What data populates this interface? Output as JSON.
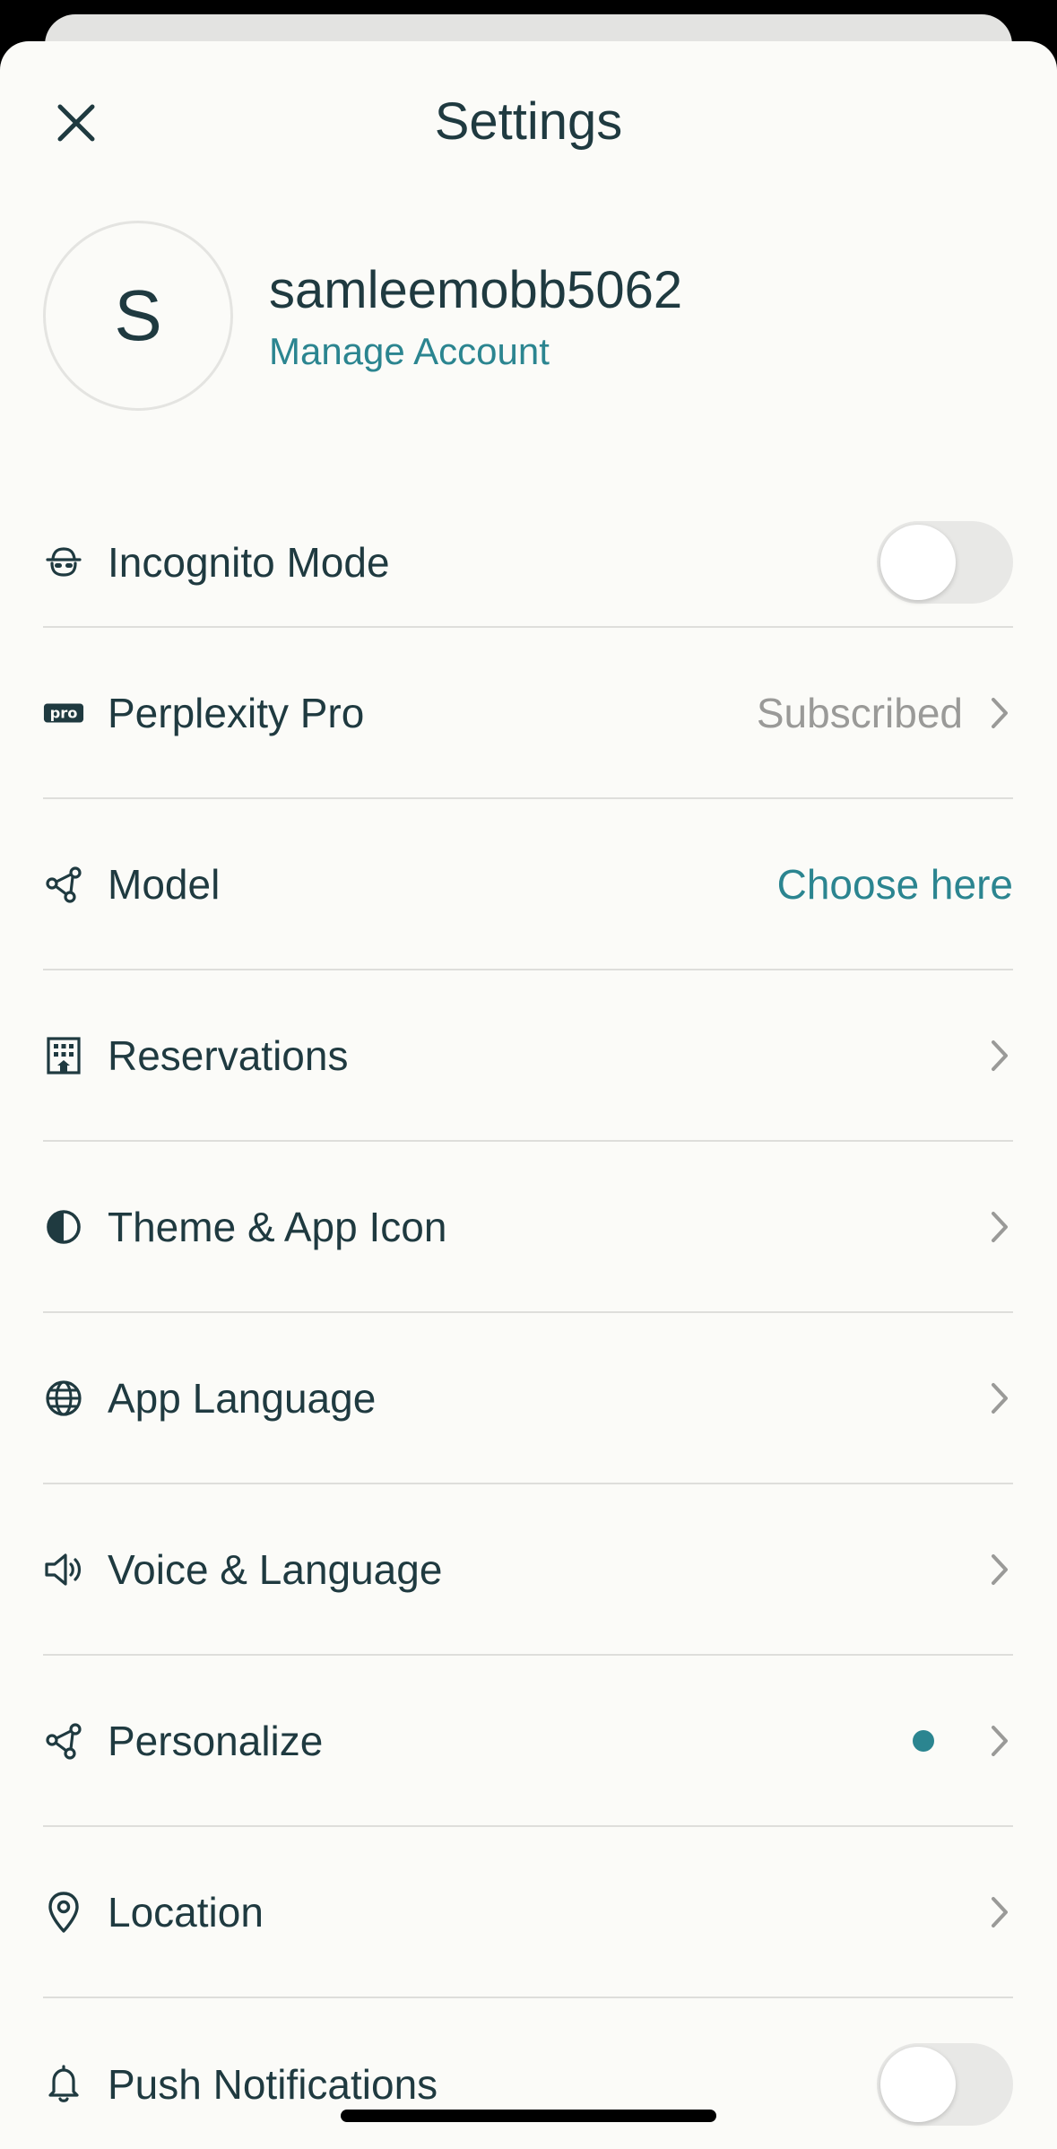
{
  "header": {
    "title": "Settings",
    "close_icon": "close-icon"
  },
  "profile": {
    "avatar_initial": "S",
    "username": "samleemobb5062",
    "manage_label": "Manage Account"
  },
  "settings": {
    "incognito": {
      "label": "Incognito Mode",
      "icon": "incognito-icon",
      "toggle_on": false
    },
    "pro": {
      "label": "Perplexity Pro",
      "value": "Subscribed",
      "icon": "pro-badge-icon"
    },
    "model": {
      "label": "Model",
      "value": "Choose here",
      "icon": "nodes-icon"
    },
    "reservations": {
      "label": "Reservations",
      "icon": "building-icon"
    },
    "theme": {
      "label": "Theme & App Icon",
      "icon": "half-circle-icon"
    },
    "app_language": {
      "label": "App Language",
      "icon": "globe-icon"
    },
    "voice_language": {
      "label": "Voice & Language",
      "icon": "speaker-icon"
    },
    "personalize": {
      "label": "Personalize",
      "icon": "nodes-icon",
      "has_dot": true
    },
    "location": {
      "label": "Location",
      "icon": "map-pin-icon"
    },
    "push": {
      "label": "Push Notifications",
      "icon": "bell-icon",
      "toggle_on": false
    }
  },
  "colors": {
    "accent": "#2b8590",
    "text": "#1f3a40",
    "muted": "#9a9a98",
    "background": "#fbfbf8",
    "divider": "#dededb"
  }
}
